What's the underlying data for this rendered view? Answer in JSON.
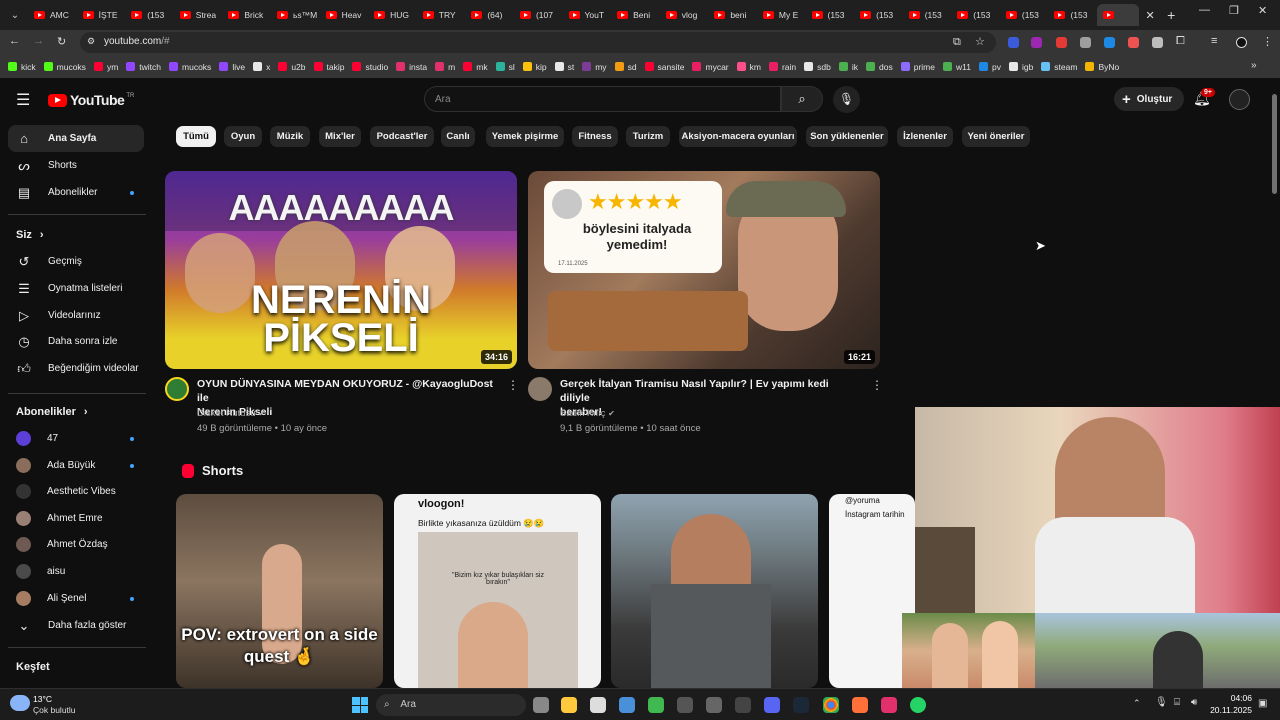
{
  "browser": {
    "tabs": [
      "AMC",
      "İŞTE",
      "(153",
      "Strea",
      "Brick",
      "ьs™M",
      "Heav",
      "HUG",
      "TRY",
      "(64)",
      "(107",
      "YouT",
      "Beni",
      "vlog",
      "beni",
      "My E",
      "(153",
      "(153",
      "(153",
      "(153",
      "(153",
      "(153"
    ],
    "url_host": "youtube.com",
    "url_path": "/#",
    "bookmarks": [
      {
        "label": "kick",
        "color": "#53fc18"
      },
      {
        "label": "mucoks",
        "color": "#53fc18"
      },
      {
        "label": "ym",
        "color": "#ff0033"
      },
      {
        "label": "twitch",
        "color": "#9146ff"
      },
      {
        "label": "mucoks",
        "color": "#9146ff"
      },
      {
        "label": "live",
        "color": "#9146ff"
      },
      {
        "label": "x",
        "color": "#e8e8e8"
      },
      {
        "label": "u2b",
        "color": "#ff0033"
      },
      {
        "label": "takip",
        "color": "#ff0033"
      },
      {
        "label": "studio",
        "color": "#ff0033"
      },
      {
        "label": "insta",
        "color": "#e1306c"
      },
      {
        "label": "m",
        "color": "#e1306c"
      },
      {
        "label": "mk",
        "color": "#ff0033"
      },
      {
        "label": "sl",
        "color": "#2bb39b"
      },
      {
        "label": "kip",
        "color": "#ffc107"
      },
      {
        "label": "st",
        "color": "#e8e8e8"
      },
      {
        "label": "my",
        "color": "#7d3c98"
      },
      {
        "label": "sd",
        "color": "#f39c12"
      },
      {
        "label": "sansite",
        "color": "#ff0033"
      },
      {
        "label": "mycar",
        "color": "#e91e63"
      },
      {
        "label": "km",
        "color": "#ff4f8b"
      },
      {
        "label": "rain",
        "color": "#e91e63"
      },
      {
        "label": "sdb",
        "color": "#e8e8e8"
      },
      {
        "label": "ik",
        "color": "#4caf50"
      },
      {
        "label": "dos",
        "color": "#4caf50"
      },
      {
        "label": "prime",
        "color": "#8e6bff"
      },
      {
        "label": "w11",
        "color": "#4caf50"
      },
      {
        "label": "pv",
        "color": "#1e88e5"
      },
      {
        "label": "igb",
        "color": "#e8e8e8"
      },
      {
        "label": "steam",
        "color": "#66c0f4"
      },
      {
        "label": "ByNo",
        "color": "#f4b400"
      }
    ]
  },
  "youtube": {
    "logo_text": "YouTube",
    "logo_region": "TR",
    "search_placeholder": "Ara",
    "create_label": "Oluştur",
    "notification_count": "9+",
    "sidebar": {
      "main_items": [
        {
          "label": "Ana Sayfa",
          "icon": "home-icon"
        },
        {
          "label": "Shorts",
          "icon": "shorts-icon"
        },
        {
          "label": "Abonelikler",
          "icon": "subscriptions-icon"
        }
      ],
      "you_title": "Siz",
      "you_items": [
        {
          "label": "Geçmiş",
          "icon": "history-icon"
        },
        {
          "label": "Oynatma listeleri",
          "icon": "playlist-icon"
        },
        {
          "label": "Videolarınız",
          "icon": "your-videos-icon"
        },
        {
          "label": "Daha sonra izle",
          "icon": "clock-icon"
        },
        {
          "label": "Beğendiğim videolar",
          "icon": "thumbs-up-icon"
        }
      ],
      "subs_title": "Abonelikler",
      "subscriptions": [
        {
          "label": "47",
          "color": "#5b3fd6",
          "new": true
        },
        {
          "label": "Ada Büyük",
          "color": "#8a6d5b",
          "new": true
        },
        {
          "label": "Aesthetic Vibes",
          "color": "#333333",
          "new": false
        },
        {
          "label": "Ahmet Emre",
          "color": "#9a7f75",
          "new": false
        },
        {
          "label": "Ahmet Özdaş",
          "color": "#6e5a52",
          "new": false
        },
        {
          "label": "aisu",
          "color": "#4a4a4a",
          "new": false
        },
        {
          "label": "Ali Şenel",
          "color": "#a57c62",
          "new": true
        }
      ],
      "show_more": "Daha fazla göster",
      "explore_title": "Keşfet"
    },
    "chips": [
      "Tümü",
      "Oyun",
      "Müzik",
      "Mix'ler",
      "Podcast'ler",
      "Canlı",
      "Yemek pişirme",
      "Fitness",
      "Turizm",
      "Aksiyon-macera oyunları",
      "Son yüklenenler",
      "İzlenenler",
      "Yeni öneriler"
    ],
    "videos": [
      {
        "title_line1": "OYUN DÜNYASINA MEYDAN OKUYORUZ - @KayaogluDost ile",
        "title_line2": "Nerenin Pikseli",
        "channel": "Disket Kutusu",
        "views": "49 B görüntüleme",
        "age": "10 ay önce",
        "duration": "34:16",
        "thumb_text_top": "AAAAAAAAA",
        "thumb_text_1": "NERENİN",
        "thumb_text_2": "PİKSELİ"
      },
      {
        "title_line1": "Gerçek İtalyan Tiramisu Nasıl Yapılır? | Ev yapımı kedi diliyle",
        "title_line2": "beraber!",
        "channel": "Sadık Kılıç",
        "views": "9,1 B görüntüleme",
        "age": "10 saat önce",
        "duration": "16:21",
        "thumb_text_1": "böylesini italyada",
        "thumb_text_2": "yemedim!",
        "thumb_date": "17.11.2025"
      }
    ],
    "shorts_title": "Shorts",
    "shorts": [
      {
        "caption": "POV: extrovert on a side quest 🤞"
      },
      {
        "header": "vloogon!",
        "caption": "Birlikte yıkasanıza üzüldüm 😢😢",
        "subcaption": "\"Bizim kız yıkar bulaşıkları siz bırakın\""
      },
      {
        "caption": ""
      },
      {
        "header": "@yoruma",
        "caption": "İnstagram tarihin"
      }
    ]
  },
  "taskbar": {
    "weather_temp": "13°C",
    "weather_desc": "Çok bulutlu",
    "search_label": "Ara",
    "time": "04:06",
    "date": "20.11.2025"
  }
}
